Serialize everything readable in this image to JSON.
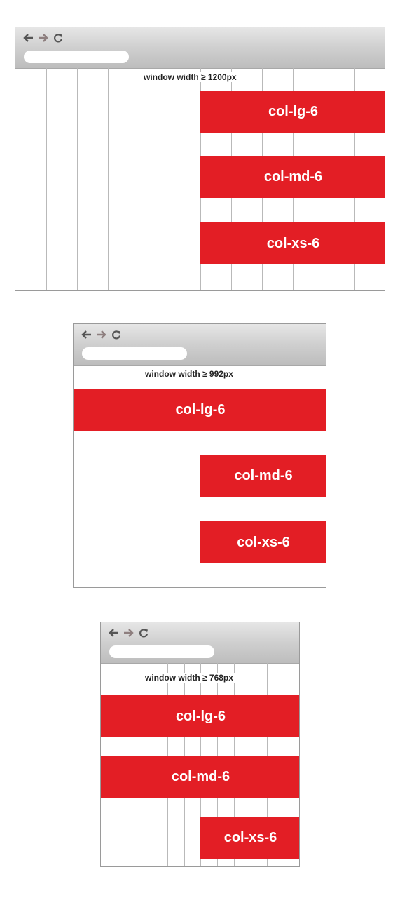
{
  "colors": {
    "bar": "#e31e25",
    "bar_text": "#ffffff",
    "gridline": "#b9b9b9",
    "chrome": "#cfcfcf",
    "back_arrow": "#555555",
    "forward_arrow": "#8e7f7f",
    "reload": "#555555"
  },
  "icons": [
    "back-arrow-icon",
    "forward-arrow-icon",
    "reload-icon"
  ],
  "panels": [
    {
      "width_label": "window width ≥ 1200px",
      "bars": [
        {
          "label": "col-lg-6",
          "span": "right-half"
        },
        {
          "label": "col-md-6",
          "span": "right-half"
        },
        {
          "label": "col-xs-6",
          "span": "right-half"
        }
      ]
    },
    {
      "width_label": "window width ≥ 992px",
      "bars": [
        {
          "label": "col-lg-6",
          "span": "full"
        },
        {
          "label": "col-md-6",
          "span": "right-half"
        },
        {
          "label": "col-xs-6",
          "span": "right-half"
        }
      ]
    },
    {
      "width_label": "window width ≥ 768px",
      "bars": [
        {
          "label": "col-lg-6",
          "span": "full"
        },
        {
          "label": "col-md-6",
          "span": "full"
        },
        {
          "label": "col-xs-6",
          "span": "right-half"
        }
      ]
    }
  ]
}
